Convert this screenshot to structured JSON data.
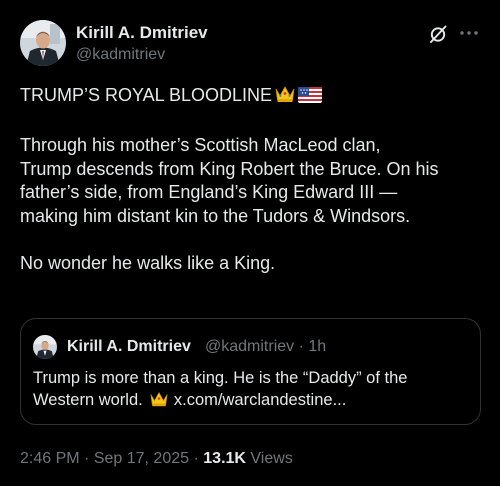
{
  "author": {
    "display_name": "Kirill A. Dmitriev",
    "handle": "@kadmitriev"
  },
  "header_icons": [
    "grok-icon",
    "more-icon"
  ],
  "tweet": {
    "title_line": "TRUMP’S ROYAL BLOODLINE",
    "title_emojis": [
      "crown-emoji",
      "us-flag-emoji"
    ],
    "paragraph_1": "Through his mother’s Scottish MacLeod clan,\nTrump descends from King Robert the Bruce. On his\nfather’s side, from England’s King Edward III —\nmaking him distant kin to the Tudors & Windsors.",
    "paragraph_2": "No wonder he walks like a King."
  },
  "quote": {
    "display_name": "Kirill A. Dmitriev",
    "handle": "@kadmitriev",
    "separator": "·",
    "time": "1h",
    "text_line_1": "Trump is more than a king. He is the “Daddy” of the",
    "text_line_2_prefix": "Western world.",
    "link_text": "x.com/warclandestine..."
  },
  "footer": {
    "time": "2:46 PM",
    "separator": "·",
    "date": "Sep 17, 2025",
    "separator_2": "·",
    "views_count": "13.1K",
    "views_label": "Views"
  },
  "colors": {
    "background": "#000000",
    "text_primary": "#e7e9ea",
    "text_secondary": "#71767b",
    "border": "#2f3336"
  }
}
